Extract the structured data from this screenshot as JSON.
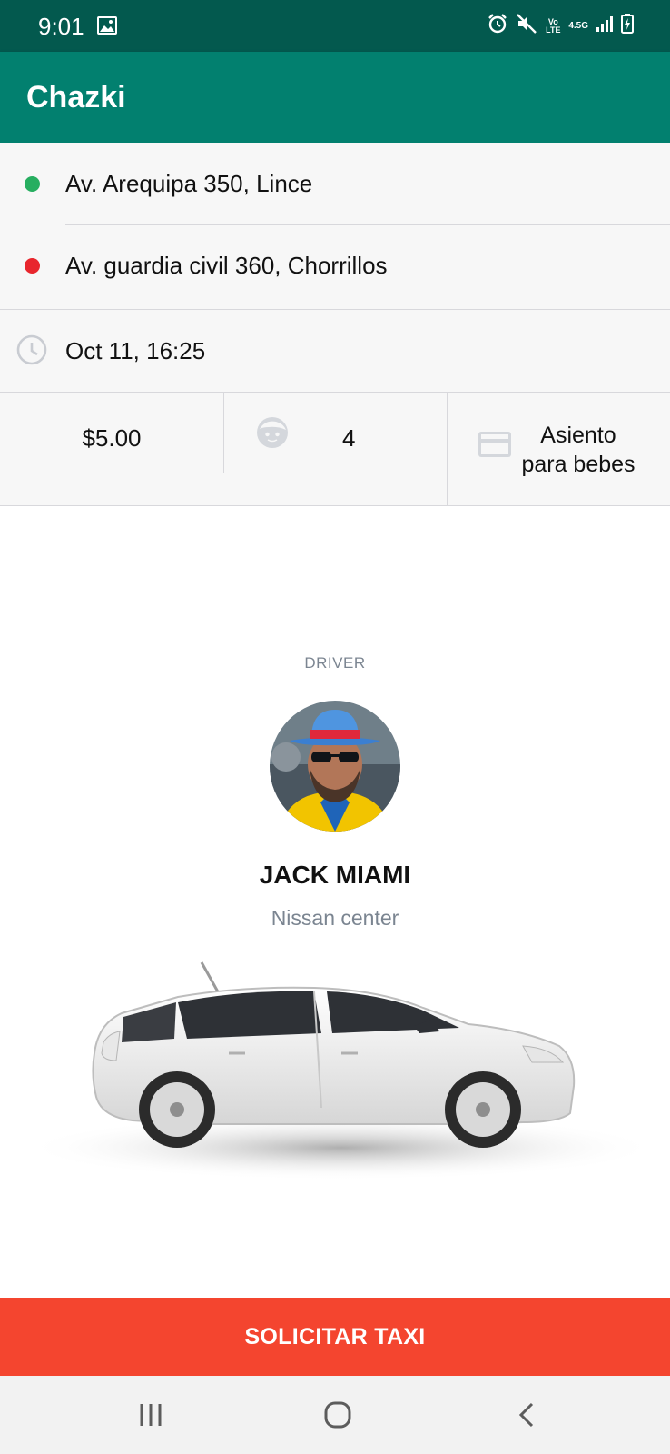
{
  "status_bar": {
    "time": "9:01",
    "icons": [
      "image-icon",
      "alarm-icon",
      "mute-icon",
      "volte-icon",
      "4g-data-icon",
      "signal-icon",
      "battery-charging-icon"
    ],
    "volte_text": "Vo LTE",
    "network_text": "4.5G"
  },
  "app_bar": {
    "title": "Chazki"
  },
  "trip": {
    "origin": {
      "address": "Av. Arequipa 350, Lince",
      "dot_color": "#27ae60"
    },
    "destination": {
      "address": "Av. guardia civil 360, Chorrillos",
      "dot_color": "#e8262d"
    },
    "datetime": {
      "icon": "clock-icon",
      "value": "Oct 11, 16:25"
    },
    "price": "$5.00",
    "passengers": {
      "icon": "face-icon",
      "value": "4"
    },
    "baby_seat": {
      "icon": "card-icon",
      "line1": "Asiento",
      "line2": "para bebes"
    }
  },
  "driver": {
    "caption": "DRIVER",
    "name": "JACK MIAMI",
    "company": "Nissan center",
    "avatar": "driver-photo",
    "vehicle": "white-hatchback-car"
  },
  "actions": {
    "request_label": "SOLICITAR TAXI",
    "accent": "#f4452f"
  },
  "nav_bar": {
    "buttons": [
      "recent-apps-icon",
      "home-icon",
      "back-icon"
    ]
  },
  "colors": {
    "status_bar": "#03594e",
    "app_bar": "#02806f",
    "panel": "#f7f7f7"
  }
}
